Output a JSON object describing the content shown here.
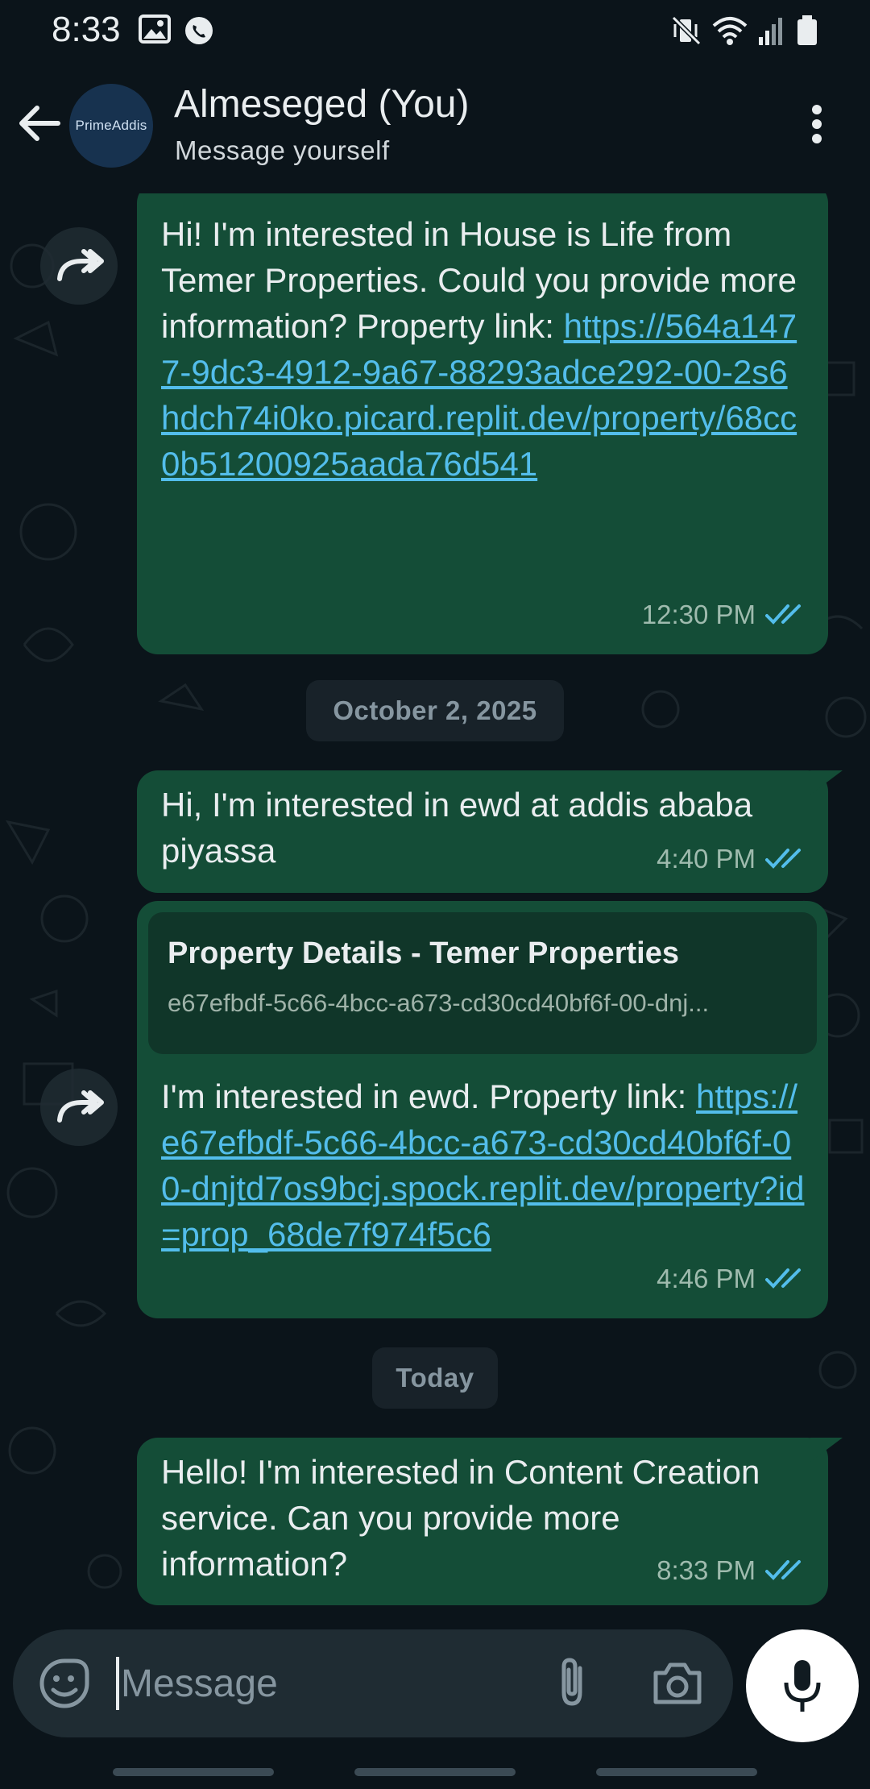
{
  "status_bar": {
    "time": "8:33"
  },
  "header": {
    "avatar_text": "PrimeAddis",
    "name": "Almeseged (You)",
    "subtitle": "Message yourself"
  },
  "messages": [
    {
      "text": "Hi! I'm interested in House is Life from Temer Properties. Could you provide more information? Property link: ",
      "link": "https://564a1477-9dc3-4912-9a67-88293adce292-00-2s6hdch74i0ko.picard.replit.dev/property/68cc0b51200925aada76d541",
      "time": "12:30 PM",
      "status": "read"
    },
    {
      "text": "Hi, I'm interested in ewd at addis ababa piyassa",
      "time": "4:40 PM",
      "status": "read"
    },
    {
      "preview_title": "Property Details - Temer Properties",
      "preview_url": "e67efbdf-5c66-4bcc-a673-cd30cd40bf6f-00-dnj...",
      "text": "I'm interested in ewd. Property link: ",
      "link": "https://e67efbdf-5c66-4bcc-a673-cd30cd40bf6f-00-dnjtd7os9bcj.spock.replit.dev/property?id=prop_68de7f974f5c6",
      "time": "4:46 PM",
      "status": "read"
    },
    {
      "text": "Hello! I'm interested in Content Creation service. Can you provide more information?",
      "time": "8:33 PM",
      "status": "read"
    }
  ],
  "date_separators": [
    "October 2, 2025",
    "Today"
  ],
  "input": {
    "placeholder": "Message"
  },
  "colors": {
    "background": "#0b141a",
    "outgoing_bubble": "#144d37",
    "link": "#53bdeb",
    "read_ticks": "#53bdeb"
  }
}
